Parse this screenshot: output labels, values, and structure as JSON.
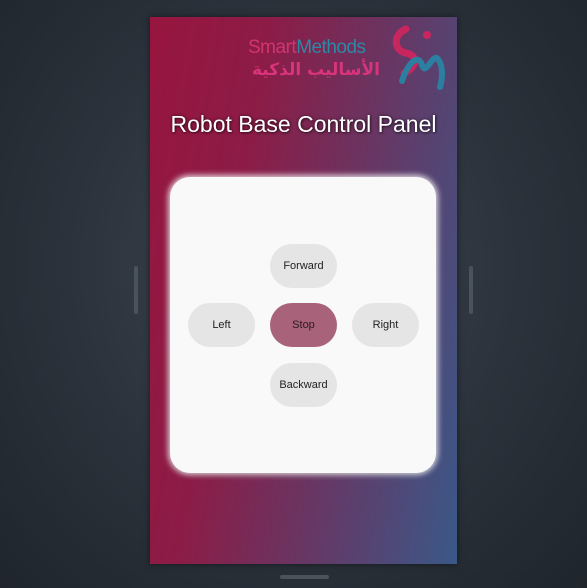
{
  "logo": {
    "en_part1": "Smart",
    "en_part2": "Methods",
    "ar": "الأساليب الذكية",
    "colors": {
      "pink": "#d1356e",
      "teal": "#2b89a6"
    }
  },
  "title": "Robot Base Control Panel",
  "controls": {
    "forward": "Forward",
    "left": "Left",
    "stop": "Stop",
    "right": "Right",
    "backward": "Backward"
  },
  "colors": {
    "gradient_start": "#97153f",
    "gradient_end": "#3a5888",
    "stop_button": "#a8637a",
    "button": "#e5e5e5",
    "card": "#f9f9f9"
  }
}
